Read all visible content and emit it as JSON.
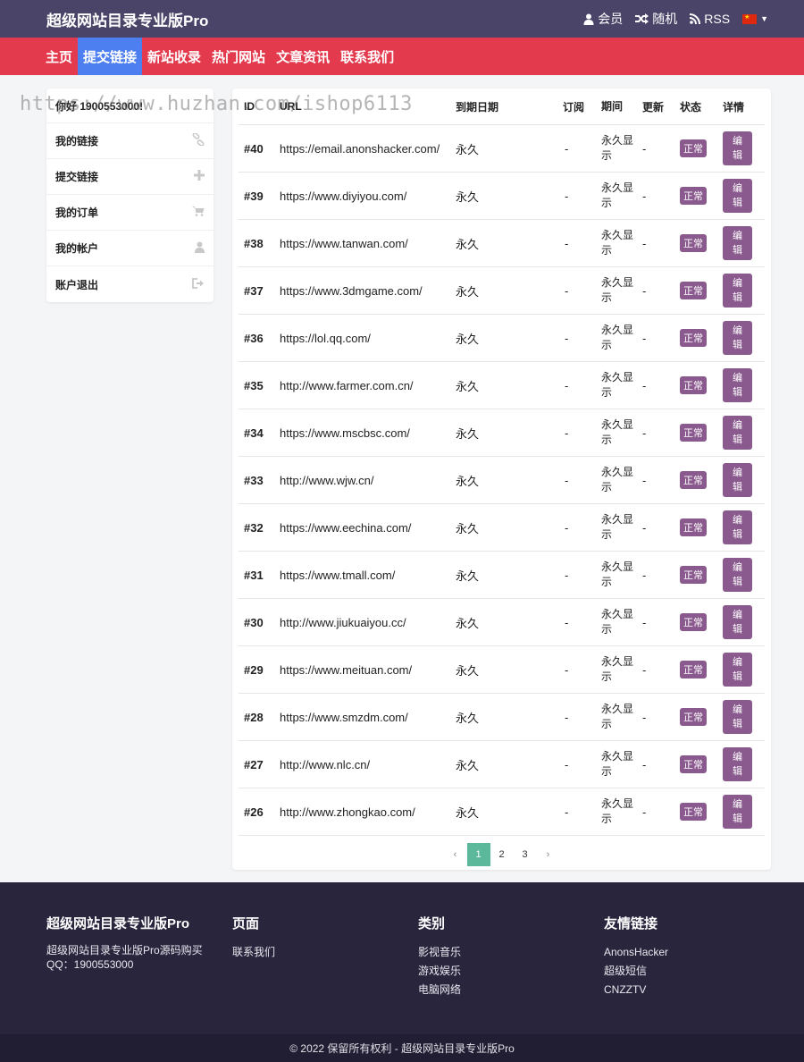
{
  "header": {
    "site_title": "超级网站目录专业版Pro",
    "member": "会员",
    "random": "随机",
    "rss": "RSS"
  },
  "nav": [
    "主页",
    "提交链接",
    "新站收录",
    "热门网站",
    "文章资讯",
    "联系我们"
  ],
  "nav_active": "提交链接",
  "sidebar": {
    "greeting": "你好 1900553000!",
    "items": [
      {
        "label": "我的链接",
        "icon": "link-icon"
      },
      {
        "label": "提交链接",
        "icon": "plus-icon"
      },
      {
        "label": "我的订单",
        "icon": "cart-icon"
      },
      {
        "label": "我的帐户",
        "icon": "user-icon"
      },
      {
        "label": "账户退出",
        "icon": "logout-icon"
      }
    ]
  },
  "watermark": "https://www.huzhan.com/ishop6113",
  "table": {
    "headers": [
      "ID",
      "URL",
      "到期日期",
      "订阅",
      "期间",
      "更新",
      "状态",
      "详情"
    ],
    "rows": [
      {
        "id": "#40",
        "url": "https://email.anonshacker.com/",
        "expire": "永久",
        "sub": "-",
        "period": "永久显示",
        "update": "-",
        "status": "正常",
        "action": "编辑"
      },
      {
        "id": "#39",
        "url": "https://www.diyiyou.com/",
        "expire": "永久",
        "sub": "-",
        "period": "永久显示",
        "update": "-",
        "status": "正常",
        "action": "编辑"
      },
      {
        "id": "#38",
        "url": "https://www.tanwan.com/",
        "expire": "永久",
        "sub": "-",
        "period": "永久显示",
        "update": "-",
        "status": "正常",
        "action": "编辑"
      },
      {
        "id": "#37",
        "url": "https://www.3dmgame.com/",
        "expire": "永久",
        "sub": "-",
        "period": "永久显示",
        "update": "-",
        "status": "正常",
        "action": "编辑"
      },
      {
        "id": "#36",
        "url": "https://lol.qq.com/",
        "expire": "永久",
        "sub": "-",
        "period": "永久显示",
        "update": "-",
        "status": "正常",
        "action": "编辑"
      },
      {
        "id": "#35",
        "url": "http://www.farmer.com.cn/",
        "expire": "永久",
        "sub": "-",
        "period": "永久显示",
        "update": "-",
        "status": "正常",
        "action": "编辑"
      },
      {
        "id": "#34",
        "url": "https://www.mscbsc.com/",
        "expire": "永久",
        "sub": "-",
        "period": "永久显示",
        "update": "-",
        "status": "正常",
        "action": "编辑"
      },
      {
        "id": "#33",
        "url": "http://www.wjw.cn/",
        "expire": "永久",
        "sub": "-",
        "period": "永久显示",
        "update": "-",
        "status": "正常",
        "action": "编辑"
      },
      {
        "id": "#32",
        "url": "https://www.eechina.com/",
        "expire": "永久",
        "sub": "-",
        "period": "永久显示",
        "update": "-",
        "status": "正常",
        "action": "编辑"
      },
      {
        "id": "#31",
        "url": "https://www.tmall.com/",
        "expire": "永久",
        "sub": "-",
        "period": "永久显示",
        "update": "-",
        "status": "正常",
        "action": "编辑"
      },
      {
        "id": "#30",
        "url": "http://www.jiukuaiyou.cc/",
        "expire": "永久",
        "sub": "-",
        "period": "永久显示",
        "update": "-",
        "status": "正常",
        "action": "编辑"
      },
      {
        "id": "#29",
        "url": "https://www.meituan.com/",
        "expire": "永久",
        "sub": "-",
        "period": "永久显示",
        "update": "-",
        "status": "正常",
        "action": "编辑"
      },
      {
        "id": "#28",
        "url": "https://www.smzdm.com/",
        "expire": "永久",
        "sub": "-",
        "period": "永久显示",
        "update": "-",
        "status": "正常",
        "action": "编辑"
      },
      {
        "id": "#27",
        "url": "http://www.nlc.cn/",
        "expire": "永久",
        "sub": "-",
        "period": "永久显示",
        "update": "-",
        "status": "正常",
        "action": "编辑"
      },
      {
        "id": "#26",
        "url": "http://www.zhongkao.com/",
        "expire": "永久",
        "sub": "-",
        "period": "永久显示",
        "update": "-",
        "status": "正常",
        "action": "编辑"
      }
    ]
  },
  "pagination": {
    "prev": "‹",
    "pages": [
      "1",
      "2",
      "3"
    ],
    "current": "1",
    "next": "›"
  },
  "footer": {
    "about_title": "超级网站目录专业版Pro",
    "about_desc": "超级网站目录专业版Pro源码购买QQ：1900553000",
    "pages_title": "页面",
    "pages_links": [
      "联系我们"
    ],
    "category_title": "类别",
    "category_links": [
      "影视音乐",
      "游戏娱乐",
      "电脑网络"
    ],
    "friends_title": "友情链接",
    "friends_links": [
      "AnonsHacker",
      "超级短信",
      "CNZZTV"
    ],
    "copyright": "© 2022 保留所有权利 - 超级网站目录专业版Pro"
  },
  "colors": {
    "topbar": "#4a4468",
    "navbar": "#e33a4d",
    "nav_active": "#4e7ff0",
    "badge": "#8a5a8e",
    "page_current": "#5cb89a",
    "footer": "#28253d"
  }
}
